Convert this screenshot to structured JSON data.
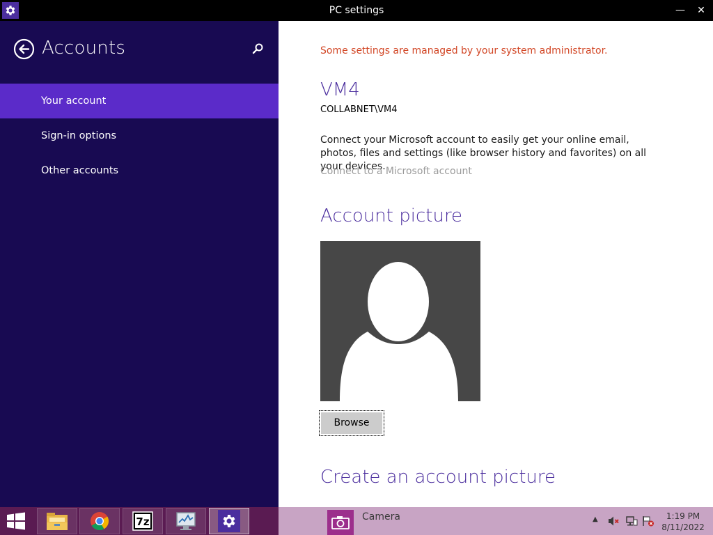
{
  "window": {
    "title": "PC settings",
    "minimize_glyph": "—",
    "close_glyph": "✕"
  },
  "sidebar": {
    "title": "Accounts",
    "items": [
      {
        "label": "Your account",
        "selected": true
      },
      {
        "label": "Sign-in options",
        "selected": false
      },
      {
        "label": "Other accounts",
        "selected": false
      }
    ]
  },
  "main": {
    "admin_notice": "Some settings are managed by your system administrator.",
    "account_name": "VM4",
    "account_domain": "COLLABNET\\VM4",
    "connect_description": "Connect your Microsoft account to easily get your online email, photos, files and settings (like browser history and favorites) on all your devices.",
    "connect_link": "Connect to a Microsoft account",
    "account_picture_heading": "Account picture",
    "browse_label": "Browse",
    "create_picture_heading": "Create an account picture"
  },
  "taskbar": {
    "apps": [
      "file-explorer-icon",
      "chrome-icon",
      "7zip-icon",
      "resource-monitor-icon",
      "settings-icon"
    ],
    "camera_label": "Camera",
    "tray_arrow": "▲",
    "clock_time": "1:19 PM",
    "clock_date": "8/11/2022"
  },
  "colors": {
    "sidebar_bg": "#180a52",
    "selected_bg": "#5b2bc9",
    "accent": "#4b2e9e",
    "admin_notice": "#d24726",
    "taskbar_bg": "#5a1b52",
    "taskbar_right": "#c8a4c4"
  }
}
